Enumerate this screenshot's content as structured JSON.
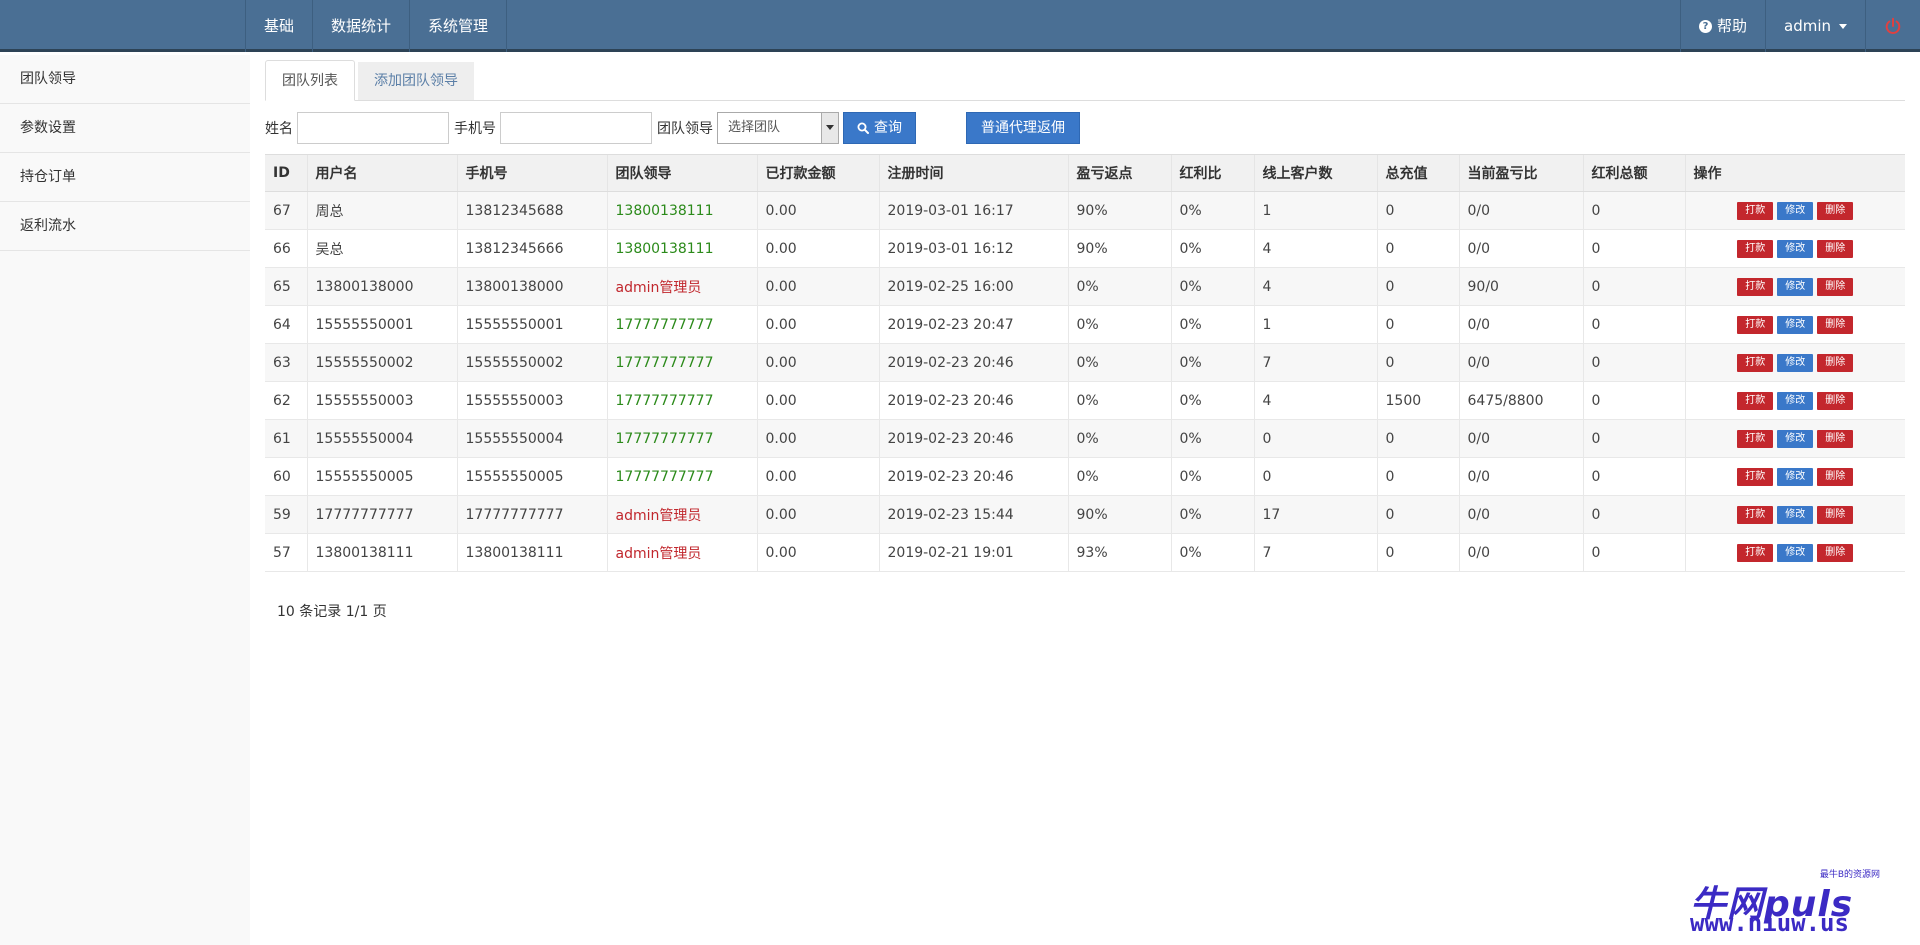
{
  "topnav": {
    "left": [
      "基础",
      "数据统计",
      "系统管理"
    ],
    "help": "帮助",
    "user": "admin"
  },
  "sidebar": [
    "团队领导",
    "参数设置",
    "持仓订单",
    "返利流水"
  ],
  "tabs": [
    "团队列表",
    "添加团队领导"
  ],
  "filter": {
    "name_label": "姓名",
    "phone_label": "手机号",
    "team_label": "团队领导",
    "team_select": "选择团队",
    "search_btn": "查询",
    "agent_btn": "普通代理返佣"
  },
  "table": {
    "headers": [
      "ID",
      "用户名",
      "手机号",
      "团队领导",
      "已打款金额",
      "注册时间",
      "盈亏返点",
      "红利比",
      "线上客户数",
      "总充值",
      "当前盈亏比",
      "红利总额",
      "操作"
    ],
    "rows": [
      [
        "67",
        "周总",
        "13812345688",
        "13800138111",
        "0.00",
        "2019-03-01 16:17",
        "90%",
        "0%",
        "1",
        "0",
        "0/0",
        "0"
      ],
      [
        "66",
        "吴总",
        "13812345666",
        "13800138111",
        "0.00",
        "2019-03-01 16:12",
        "90%",
        "0%",
        "4",
        "0",
        "0/0",
        "0"
      ],
      [
        "65",
        "13800138000",
        "13800138000",
        "admin管理员",
        "0.00",
        "2019-02-25 16:00",
        "0%",
        "0%",
        "4",
        "0",
        "90/0",
        "0"
      ],
      [
        "64",
        "15555550001",
        "15555550001",
        "17777777777",
        "0.00",
        "2019-02-23 20:47",
        "0%",
        "0%",
        "1",
        "0",
        "0/0",
        "0"
      ],
      [
        "63",
        "15555550002",
        "15555550002",
        "17777777777",
        "0.00",
        "2019-02-23 20:46",
        "0%",
        "0%",
        "7",
        "0",
        "0/0",
        "0"
      ],
      [
        "62",
        "15555550003",
        "15555550003",
        "17777777777",
        "0.00",
        "2019-02-23 20:46",
        "0%",
        "0%",
        "4",
        "1500",
        "6475/8800",
        "0"
      ],
      [
        "61",
        "15555550004",
        "15555550004",
        "17777777777",
        "0.00",
        "2019-02-23 20:46",
        "0%",
        "0%",
        "0",
        "0",
        "0/0",
        "0"
      ],
      [
        "60",
        "15555550005",
        "15555550005",
        "17777777777",
        "0.00",
        "2019-02-23 20:46",
        "0%",
        "0%",
        "0",
        "0",
        "0/0",
        "0"
      ],
      [
        "59",
        "17777777777",
        "17777777777",
        "admin管理员",
        "0.00",
        "2019-02-23 15:44",
        "90%",
        "0%",
        "17",
        "0",
        "0/0",
        "0"
      ],
      [
        "57",
        "13800138111",
        "13800138111",
        "admin管理员",
        "0.00",
        "2019-02-21 19:01",
        "93%",
        "0%",
        "7",
        "0",
        "0/0",
        "0"
      ]
    ],
    "leader_colors": [
      "green",
      "green",
      "red",
      "green",
      "green",
      "green",
      "green",
      "green",
      "red",
      "red"
    ],
    "ops": [
      "打款",
      "修改",
      "删除"
    ]
  },
  "footer": "10 条记录 1/1 页",
  "watermark": {
    "main": "牛网puls",
    "sub": "最牛B的资源网",
    "url": "www.niuw.us"
  },
  "colors": {
    "topbar": "#4a6f94",
    "accent_blue": "#3a78c9",
    "danger_red": "#c3272d",
    "leader_green": "#2b8a1a"
  }
}
